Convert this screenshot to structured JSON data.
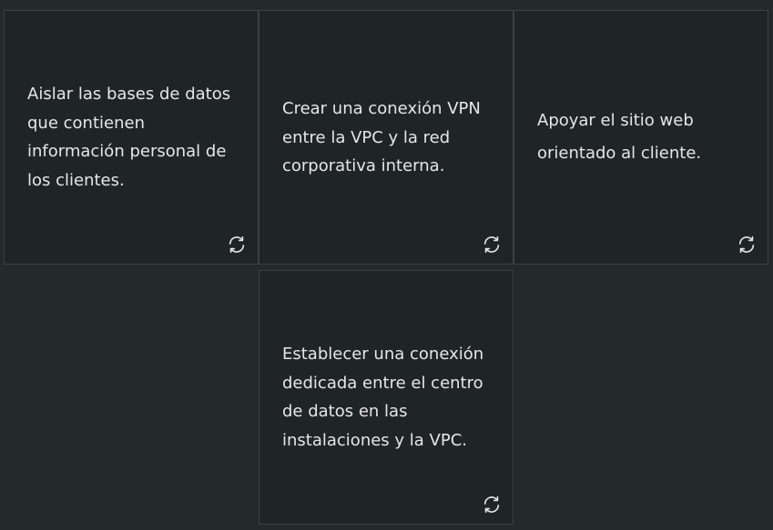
{
  "cards": [
    {
      "text": "Aislar las bases de datos que contienen información personal de los clientes.",
      "icon": "flip-icon"
    },
    {
      "text": "Crear una conexión VPN entre la VPC y la red corporativa interna.",
      "icon": "flip-icon"
    },
    {
      "text": "Apoyar el sitio web orientado al cliente.",
      "icon": "flip-icon"
    },
    {
      "text": "Establecer una conexión dedicada entre el centro de datos en las instalaciones y la VPC.",
      "icon": "flip-icon"
    }
  ],
  "colors": {
    "background": "#222a2a",
    "card": "#1f2525",
    "border": "#3a4242",
    "text": "#e6e6e6"
  }
}
